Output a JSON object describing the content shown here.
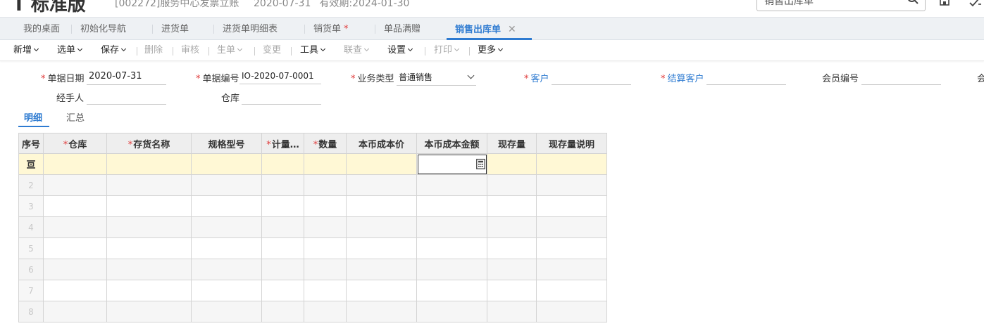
{
  "header": {
    "brand": "标准版",
    "company": "[002272]服务中心发票立账",
    "date": "2020-07-31",
    "expiry": "有效期:2024-01-30",
    "search_value": "销售出库单"
  },
  "tabs": [
    {
      "label": "我的桌面"
    },
    {
      "label": "初始化导航"
    },
    {
      "label": "进货单"
    },
    {
      "label": "进货单明细表"
    },
    {
      "label": "销货单",
      "marker": "*"
    },
    {
      "label": "单品满赠"
    },
    {
      "label": "销售出库单",
      "close": "✕"
    }
  ],
  "toolbar": [
    {
      "label": "新增"
    },
    {
      "label": "选单"
    },
    {
      "label": "保存"
    },
    {
      "label": "删除"
    },
    {
      "label": "审核"
    },
    {
      "label": "生单"
    },
    {
      "label": "变更"
    },
    {
      "label": "工具"
    },
    {
      "label": "联查"
    },
    {
      "label": "设置"
    },
    {
      "label": "打印"
    },
    {
      "label": "更多"
    }
  ],
  "form": {
    "doc_date_label": "单据日期",
    "doc_date": "2020-07-31",
    "doc_no_label": "单据编号",
    "doc_no": "IO-2020-07-0001",
    "biz_type_label": "业务类型",
    "biz_type": "普通销售",
    "customer_label": "客户",
    "settle_customer_label": "结算客户",
    "member_no_label": "会员编号",
    "member_cut": "会",
    "handler_label": "经手人",
    "warehouse_label": "仓库",
    "required_mark": "*"
  },
  "subtabs": {
    "detail": "明细",
    "summary": "汇总"
  },
  "grid": {
    "columns": [
      "序号",
      "仓库",
      "存货名称",
      "规格型号",
      "计量…",
      "数量",
      "本币成本价",
      "本币成本金额",
      "现存量",
      "现存量说明"
    ],
    "required": [
      false,
      true,
      true,
      false,
      true,
      true,
      false,
      false,
      false,
      false
    ],
    "row_numbers": [
      "2",
      "3",
      "4",
      "5",
      "6",
      "7",
      "8"
    ]
  }
}
